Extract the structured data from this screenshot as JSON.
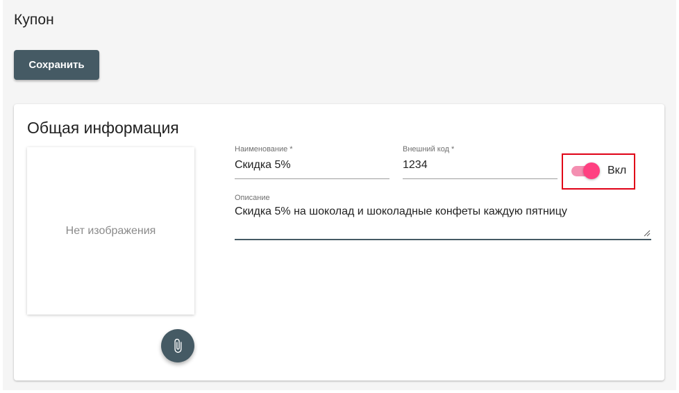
{
  "page": {
    "title": "Купон"
  },
  "toolbar": {
    "save_label": "Сохранить"
  },
  "general_info": {
    "title": "Общая информация",
    "image_placeholder": "Нет изображения",
    "attach_icon": "paperclip-icon",
    "name_field": {
      "label": "Наименование *",
      "value": "Скидка 5%"
    },
    "external_code_field": {
      "label": "Внешний код *",
      "value": "1234"
    },
    "active_toggle": {
      "label": "Вкл",
      "checked": true
    },
    "description_field": {
      "label": "Описание",
      "value": "Скидка 5% на шоколад и шоколадные конфеты каждую пятницу"
    }
  },
  "colors": {
    "primary": "#455a64",
    "accent": "#ff4081",
    "highlight": "#e00016",
    "page_background": "#f5f5f5"
  }
}
